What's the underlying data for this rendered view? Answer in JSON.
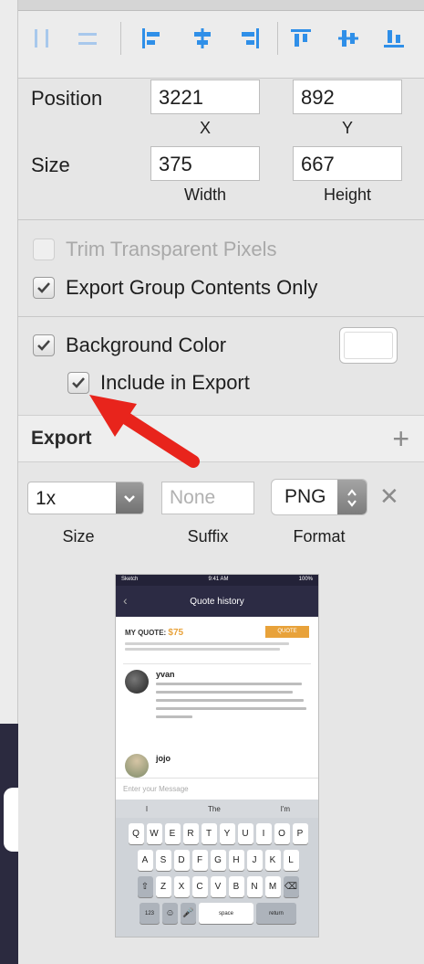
{
  "position": {
    "label": "Position",
    "x_value": "3221",
    "y_value": "892",
    "x_caption": "X",
    "y_caption": "Y"
  },
  "size": {
    "label": "Size",
    "width_value": "375",
    "height_value": "667",
    "width_caption": "Width",
    "height_caption": "Height"
  },
  "options": {
    "trim_label": "Trim Transparent Pixels",
    "trim_checked": false,
    "trim_enabled": false,
    "group_label": "Export Group Contents Only",
    "group_checked": true
  },
  "background": {
    "label": "Background Color",
    "checked": true,
    "swatch_color": "#ffffff",
    "include_label": "Include in Export",
    "include_checked": true
  },
  "export": {
    "title": "Export",
    "add_icon": "plus-icon",
    "scale_value": "1x",
    "suffix_placeholder": "None",
    "format_value": "PNG",
    "size_caption": "Size",
    "suffix_caption": "Suffix",
    "format_caption": "Format",
    "remove_icon": "close-icon"
  },
  "preview": {
    "carrier": "Sketch",
    "time": "9:41 AM",
    "battery": "100%",
    "nav_title": "Quote history",
    "quote_label": "MY QUOTE:",
    "quote_amount": "$75",
    "quote_button": "QUOTE",
    "messages": [
      {
        "name": "yvan"
      },
      {
        "name": "jojo"
      }
    ],
    "input_placeholder": "Enter your Message",
    "suggestions": [
      "I",
      "The",
      "I'm"
    ],
    "keyboard_rows": [
      [
        "Q",
        "W",
        "E",
        "R",
        "T",
        "Y",
        "U",
        "I",
        "O",
        "P"
      ],
      [
        "A",
        "S",
        "D",
        "F",
        "G",
        "H",
        "J",
        "K",
        "L"
      ],
      [
        "Z",
        "X",
        "C",
        "V",
        "B",
        "N",
        "M"
      ]
    ],
    "key_123": "123",
    "key_space": "space",
    "key_return": "return"
  },
  "colors": {
    "annotation_arrow": "#e8241c",
    "nav_bar": "#2c2b44",
    "accent_orange": "#e8a23a"
  }
}
